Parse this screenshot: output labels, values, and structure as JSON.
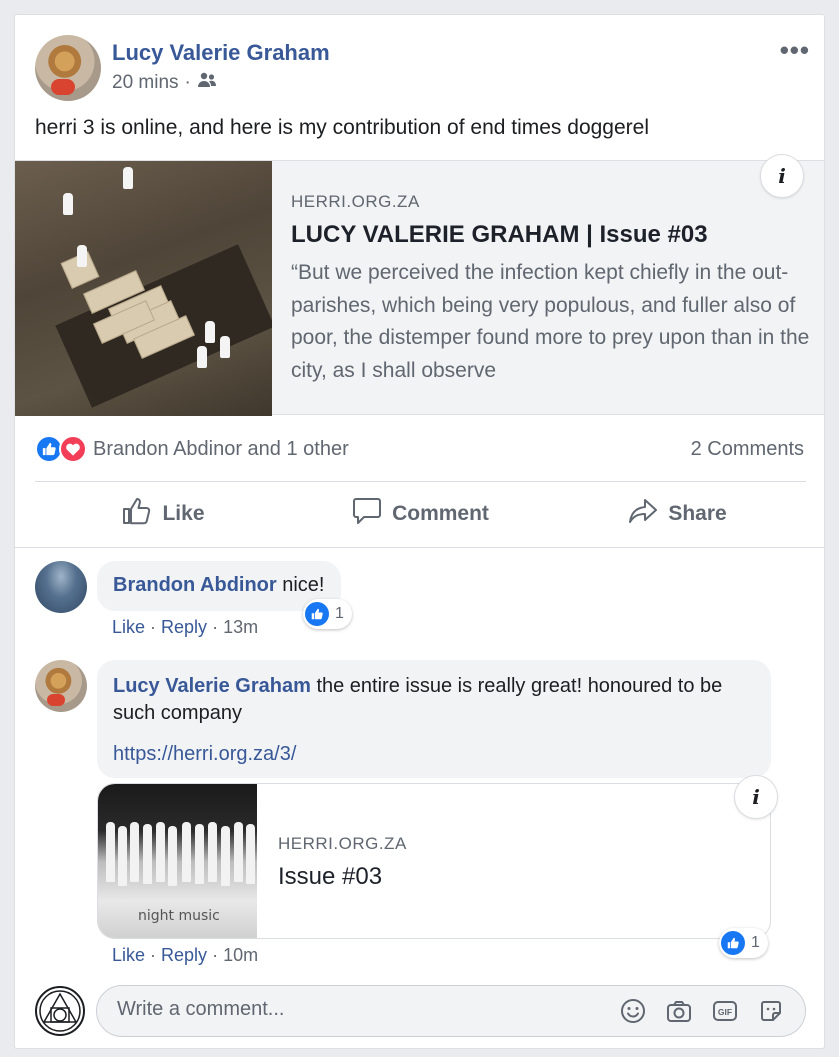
{
  "post": {
    "author": "Lucy Valerie Graham",
    "time": "20 mins",
    "dot": "·",
    "text": "herri 3 is online, and here is my contribution of end times doggerel",
    "more": "•••"
  },
  "link_preview": {
    "domain": "HERRI.ORG.ZA",
    "title": "LUCY VALERIE GRAHAM | Issue #03",
    "description": "“But we perceived the infection kept chiefly in the out-parishes, which being very populous, and fuller also of poor, the distemper found more to prey upon than in the city, as I shall observe",
    "info": "i"
  },
  "reactions": {
    "names": "Brandon Abdinor and 1 other",
    "comments_count": "2 Comments"
  },
  "actions": {
    "like": "Like",
    "comment": "Comment",
    "share": "Share"
  },
  "comments": [
    {
      "author": "Brandon Abdinor",
      "text": " nice!",
      "like": "Like",
      "reply": "Reply",
      "sep": " · ",
      "time": "13m",
      "reaction_count": "1"
    },
    {
      "author": "Lucy Valerie Graham",
      "text": " the entire issue is really great! honoured to be such company",
      "link": "https://herri.org.za/3/",
      "like": "Like",
      "reply": "Reply",
      "sep": " · ",
      "time": "10m",
      "reaction_count": "1",
      "preview": {
        "domain": "HERRI.ORG.ZA",
        "title": "Issue #03",
        "image_caption": "night music",
        "info": "i"
      }
    }
  ],
  "composer": {
    "placeholder": "Write a comment..."
  },
  "colors": {
    "link_blue": "#385898",
    "like_blue": "#1877f2",
    "love_red": "#f33e58",
    "secondary_text": "#606770"
  }
}
